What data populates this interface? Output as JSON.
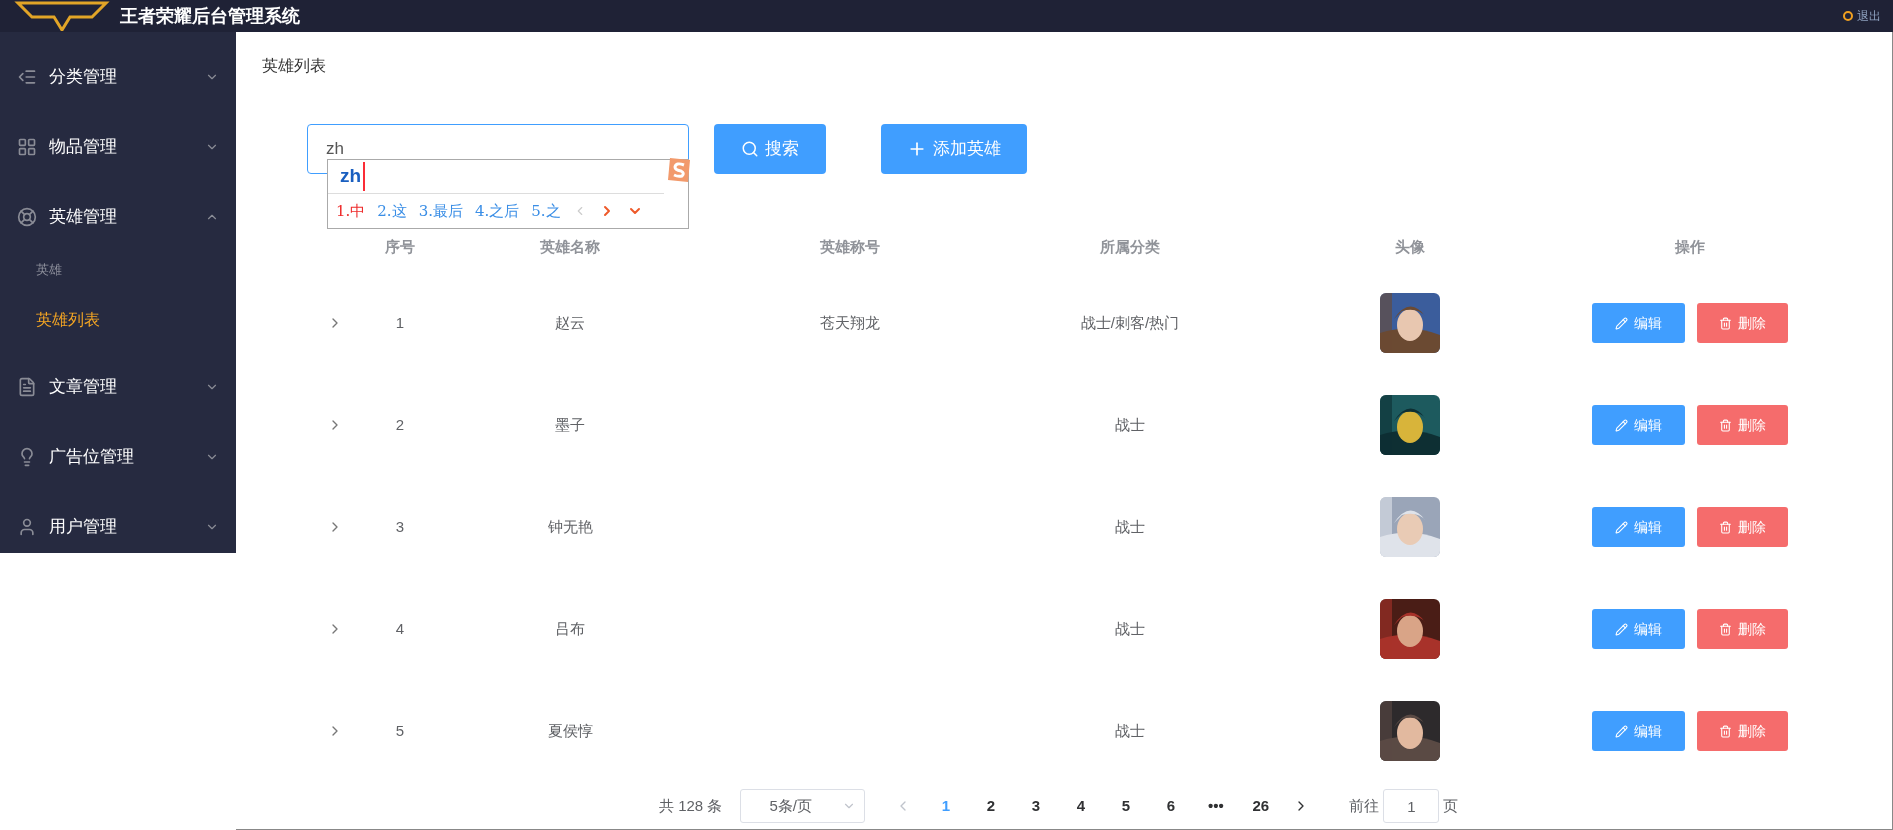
{
  "header": {
    "title": "王者荣耀后台管理系统",
    "logout": "退出"
  },
  "sidebar": {
    "items": [
      {
        "label": "分类管理",
        "expanded": false
      },
      {
        "label": "物品管理",
        "expanded": false
      },
      {
        "label": "英雄管理",
        "expanded": true,
        "children": [
          {
            "label": "英雄",
            "kind": "group"
          },
          {
            "label": "英雄列表",
            "kind": "link",
            "selected": true
          }
        ]
      },
      {
        "label": "文章管理",
        "expanded": false
      },
      {
        "label": "广告位管理",
        "expanded": false
      },
      {
        "label": "用户管理",
        "expanded": false
      }
    ]
  },
  "breadcrumb": "英雄列表",
  "search": {
    "value": "zh",
    "button": "搜索"
  },
  "add_button": "添加英雄",
  "ime": {
    "composition": "zh",
    "candidates": [
      {
        "text": "1.中",
        "selected": true
      },
      {
        "text": "2.这",
        "selected": false
      },
      {
        "text": "3.最后",
        "selected": false
      },
      {
        "text": "4.之后",
        "selected": false
      },
      {
        "text": "5.之",
        "selected": false
      }
    ]
  },
  "table": {
    "columns": [
      "序号",
      "英雄名称",
      "英雄称号",
      "所属分类",
      "头像",
      "操作"
    ],
    "rows": [
      {
        "index": "1",
        "name": "赵云",
        "title": "苍天翔龙",
        "category": "战士/刺客/热门",
        "edit": "编辑",
        "delete": "删除"
      },
      {
        "index": "2",
        "name": "墨子",
        "category": "战士",
        "edit": "编辑",
        "delete": "删除"
      },
      {
        "index": "3",
        "name": "钟无艳",
        "category": "战士",
        "edit": "编辑",
        "delete": "删除"
      },
      {
        "index": "4",
        "name": "吕布",
        "category": "战士",
        "edit": "编辑",
        "delete": "删除"
      },
      {
        "index": "5",
        "name": "夏侯惇",
        "category": "战士",
        "edit": "编辑",
        "delete": "删除"
      }
    ]
  },
  "pagination": {
    "total": "共 128 条",
    "page_size": "5条/页",
    "pages": [
      {
        "label": "1",
        "selected": true
      },
      {
        "label": "2",
        "selected": false
      },
      {
        "label": "3",
        "selected": false
      },
      {
        "label": "4",
        "selected": false
      },
      {
        "label": "5",
        "selected": false
      },
      {
        "label": "6",
        "selected": false
      },
      {
        "label": "•••",
        "selected": false
      },
      {
        "label": "26",
        "selected": false
      }
    ],
    "goto_label": "前往",
    "goto_value": "1",
    "page_unit": "页"
  }
}
